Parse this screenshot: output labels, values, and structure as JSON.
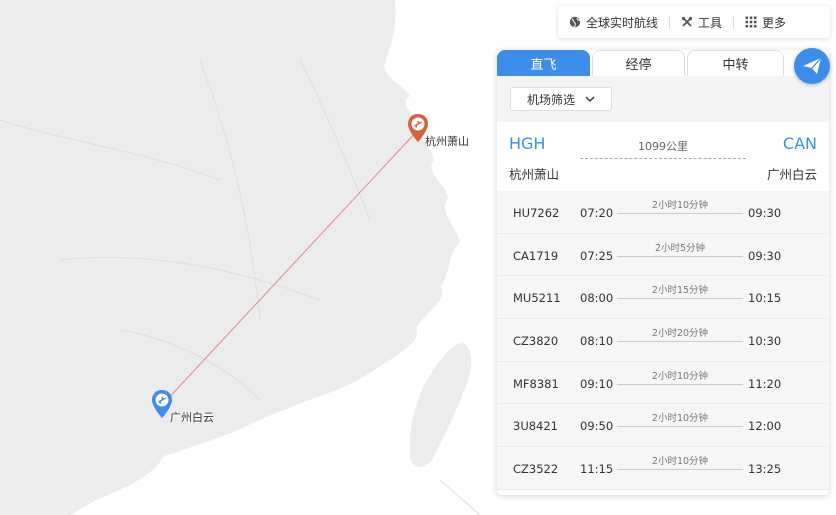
{
  "toolbar": {
    "items": [
      {
        "label": "全球实时航线",
        "icon": "globe-icon"
      },
      {
        "label": "工具",
        "icon": "tools-icon"
      },
      {
        "label": "更多",
        "icon": "grid-icon"
      }
    ]
  },
  "map": {
    "origin_label": "杭州萧山",
    "dest_label": "广州白云"
  },
  "panel": {
    "tabs": [
      "直飞",
      "经停",
      "中转"
    ],
    "filter_label": "机场筛选",
    "route": {
      "from_code": "HGH",
      "from_name": "杭州萧山",
      "to_code": "CAN",
      "to_name": "广州白云",
      "distance": "1099公里"
    },
    "flights": [
      {
        "no": "HU7262",
        "dep": "07:20",
        "dur": "2小时10分钟",
        "arr": "09:30"
      },
      {
        "no": "CA1719",
        "dep": "07:25",
        "dur": "2小时5分钟",
        "arr": "09:30"
      },
      {
        "no": "MU5211",
        "dep": "08:00",
        "dur": "2小时15分钟",
        "arr": "10:15"
      },
      {
        "no": "CZ3820",
        "dep": "08:10",
        "dur": "2小时20分钟",
        "arr": "10:30"
      },
      {
        "no": "MF8381",
        "dep": "09:10",
        "dur": "2小时10分钟",
        "arr": "11:20"
      },
      {
        "no": "3U8421",
        "dep": "09:50",
        "dur": "2小时10分钟",
        "arr": "12:00"
      },
      {
        "no": "CZ3522",
        "dep": "11:15",
        "dur": "2小时10分钟",
        "arr": "13:25"
      }
    ]
  },
  "colors": {
    "accent": "#3d8ee8",
    "origin_pin": "#d9603b",
    "dest_pin": "#3d8ee8",
    "route_line": "#e08a8a",
    "land": "#ececec",
    "water": "#ffffff"
  }
}
